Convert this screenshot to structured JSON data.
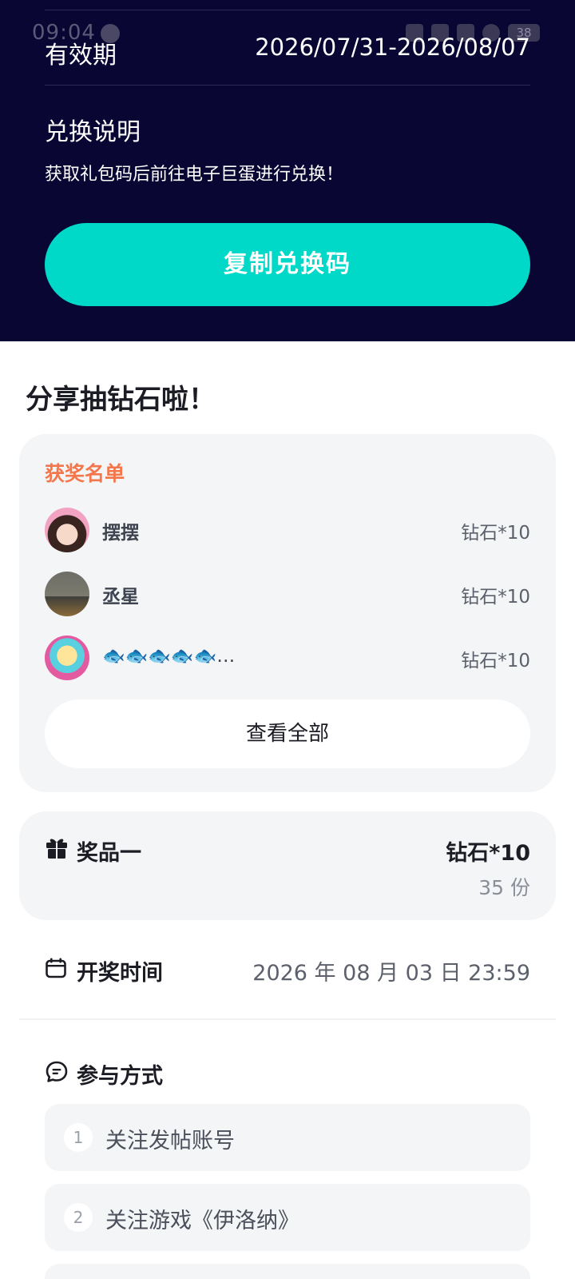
{
  "status_bar": {
    "time": "09:04",
    "battery": "38"
  },
  "redeem": {
    "validity_label": "有效期",
    "validity_value": "2026/07/31-2026/08/07",
    "instructions_title": "兑换说明",
    "instructions_text": "获取礼包码后前往电子巨蛋进行兑换！",
    "copy_button": "复制兑换码"
  },
  "share": {
    "title": "分享抽钻石啦！"
  },
  "winners": {
    "title": "获奖名单",
    "items": [
      {
        "name": "摆摆",
        "prize": "钻石*10"
      },
      {
        "name": "丞星",
        "prize": "钻石*10"
      },
      {
        "name": "🐟🐟🐟🐟🐟…",
        "prize": "钻石*10"
      }
    ],
    "view_all": "查看全部"
  },
  "prize": {
    "icon": "gift-icon",
    "label": "奖品一",
    "value": "钻石*10",
    "count": "35 份"
  },
  "draw": {
    "icon": "calendar-icon",
    "label": "开奖时间",
    "value": "2026 年 08 月 03 日 23:59"
  },
  "participate": {
    "icon": "chat-icon",
    "label": "参与方式",
    "steps": [
      {
        "num": "1",
        "text": "关注发帖账号"
      },
      {
        "num": "2",
        "text": "关注游戏《伊洛纳》"
      }
    ]
  },
  "colors": {
    "dark_bg": "#090633",
    "accent": "#00d9c7",
    "winner_title": "#f3774a"
  }
}
